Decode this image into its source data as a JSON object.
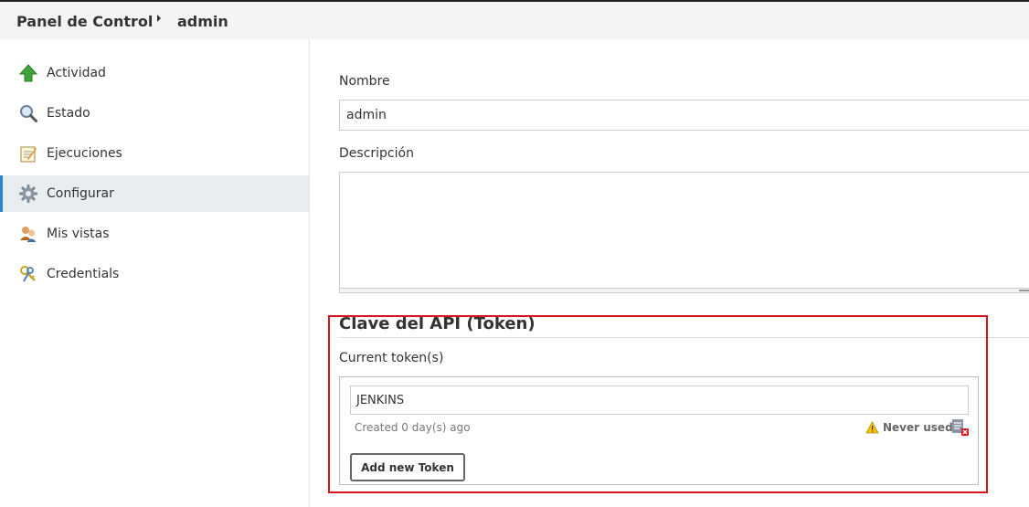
{
  "breadcrumb": {
    "items": [
      "Panel de Control",
      "admin"
    ]
  },
  "sidebar": {
    "items": [
      {
        "label": "Actividad",
        "icon": "up-arrow-icon"
      },
      {
        "label": "Estado",
        "icon": "magnifier-icon"
      },
      {
        "label": "Ejecuciones",
        "icon": "notepad-icon"
      },
      {
        "label": "Configurar",
        "icon": "gear-icon",
        "active": true
      },
      {
        "label": "Mis vistas",
        "icon": "users-icon"
      },
      {
        "label": "Credentials",
        "icon": "keys-icon"
      }
    ]
  },
  "form": {
    "name_label": "Nombre",
    "name_value": "admin",
    "description_label": "Descripción",
    "description_value": ""
  },
  "api_token": {
    "title": "Clave del API (Token)",
    "current_label": "Current token(s)",
    "token_name": "JENKINS",
    "created": "Created 0 day(s) ago",
    "status": "Never used",
    "add_button": "Add new Token"
  },
  "colors": {
    "active_accent": "#2b83d8",
    "highlight": "#d9141c",
    "warning": "#f2c200"
  }
}
